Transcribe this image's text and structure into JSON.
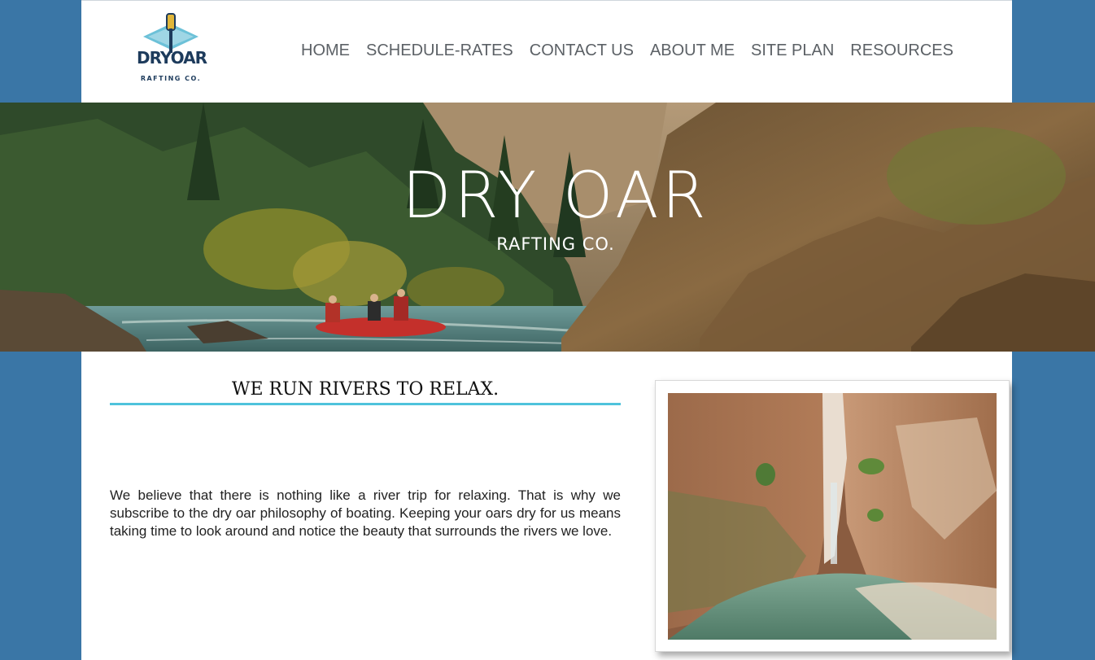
{
  "logo": {
    "word": "DRYOAR",
    "sub": "RAFTING CO."
  },
  "nav": {
    "items": [
      {
        "label": "HOME"
      },
      {
        "label": "SCHEDULE-RATES"
      },
      {
        "label": "CONTACT US"
      },
      {
        "label": "ABOUT ME"
      },
      {
        "label": "SITE PLAN"
      },
      {
        "label": "RESOURCES"
      }
    ]
  },
  "banner": {
    "title": "DRY OAR",
    "subtitle": "RAFTING CO."
  },
  "main": {
    "heading": "WE RUN RIVERS TO RELAX.",
    "paragraph": "We believe that there is nothing like a river trip for relaxing. That is why we subscribe to the dry oar philosophy of boating. Keeping your oars dry for us means taking time to look around and notice the beauty that surrounds the rivers we love."
  },
  "colors": {
    "page_background": "#3a76a6",
    "accent_rule": "#4fc3dc",
    "nav_text": "#5c6166",
    "logo_navy": "#1d3b5c",
    "logo_teal": "#6cc1d8",
    "logo_gold": "#e0b63a"
  }
}
